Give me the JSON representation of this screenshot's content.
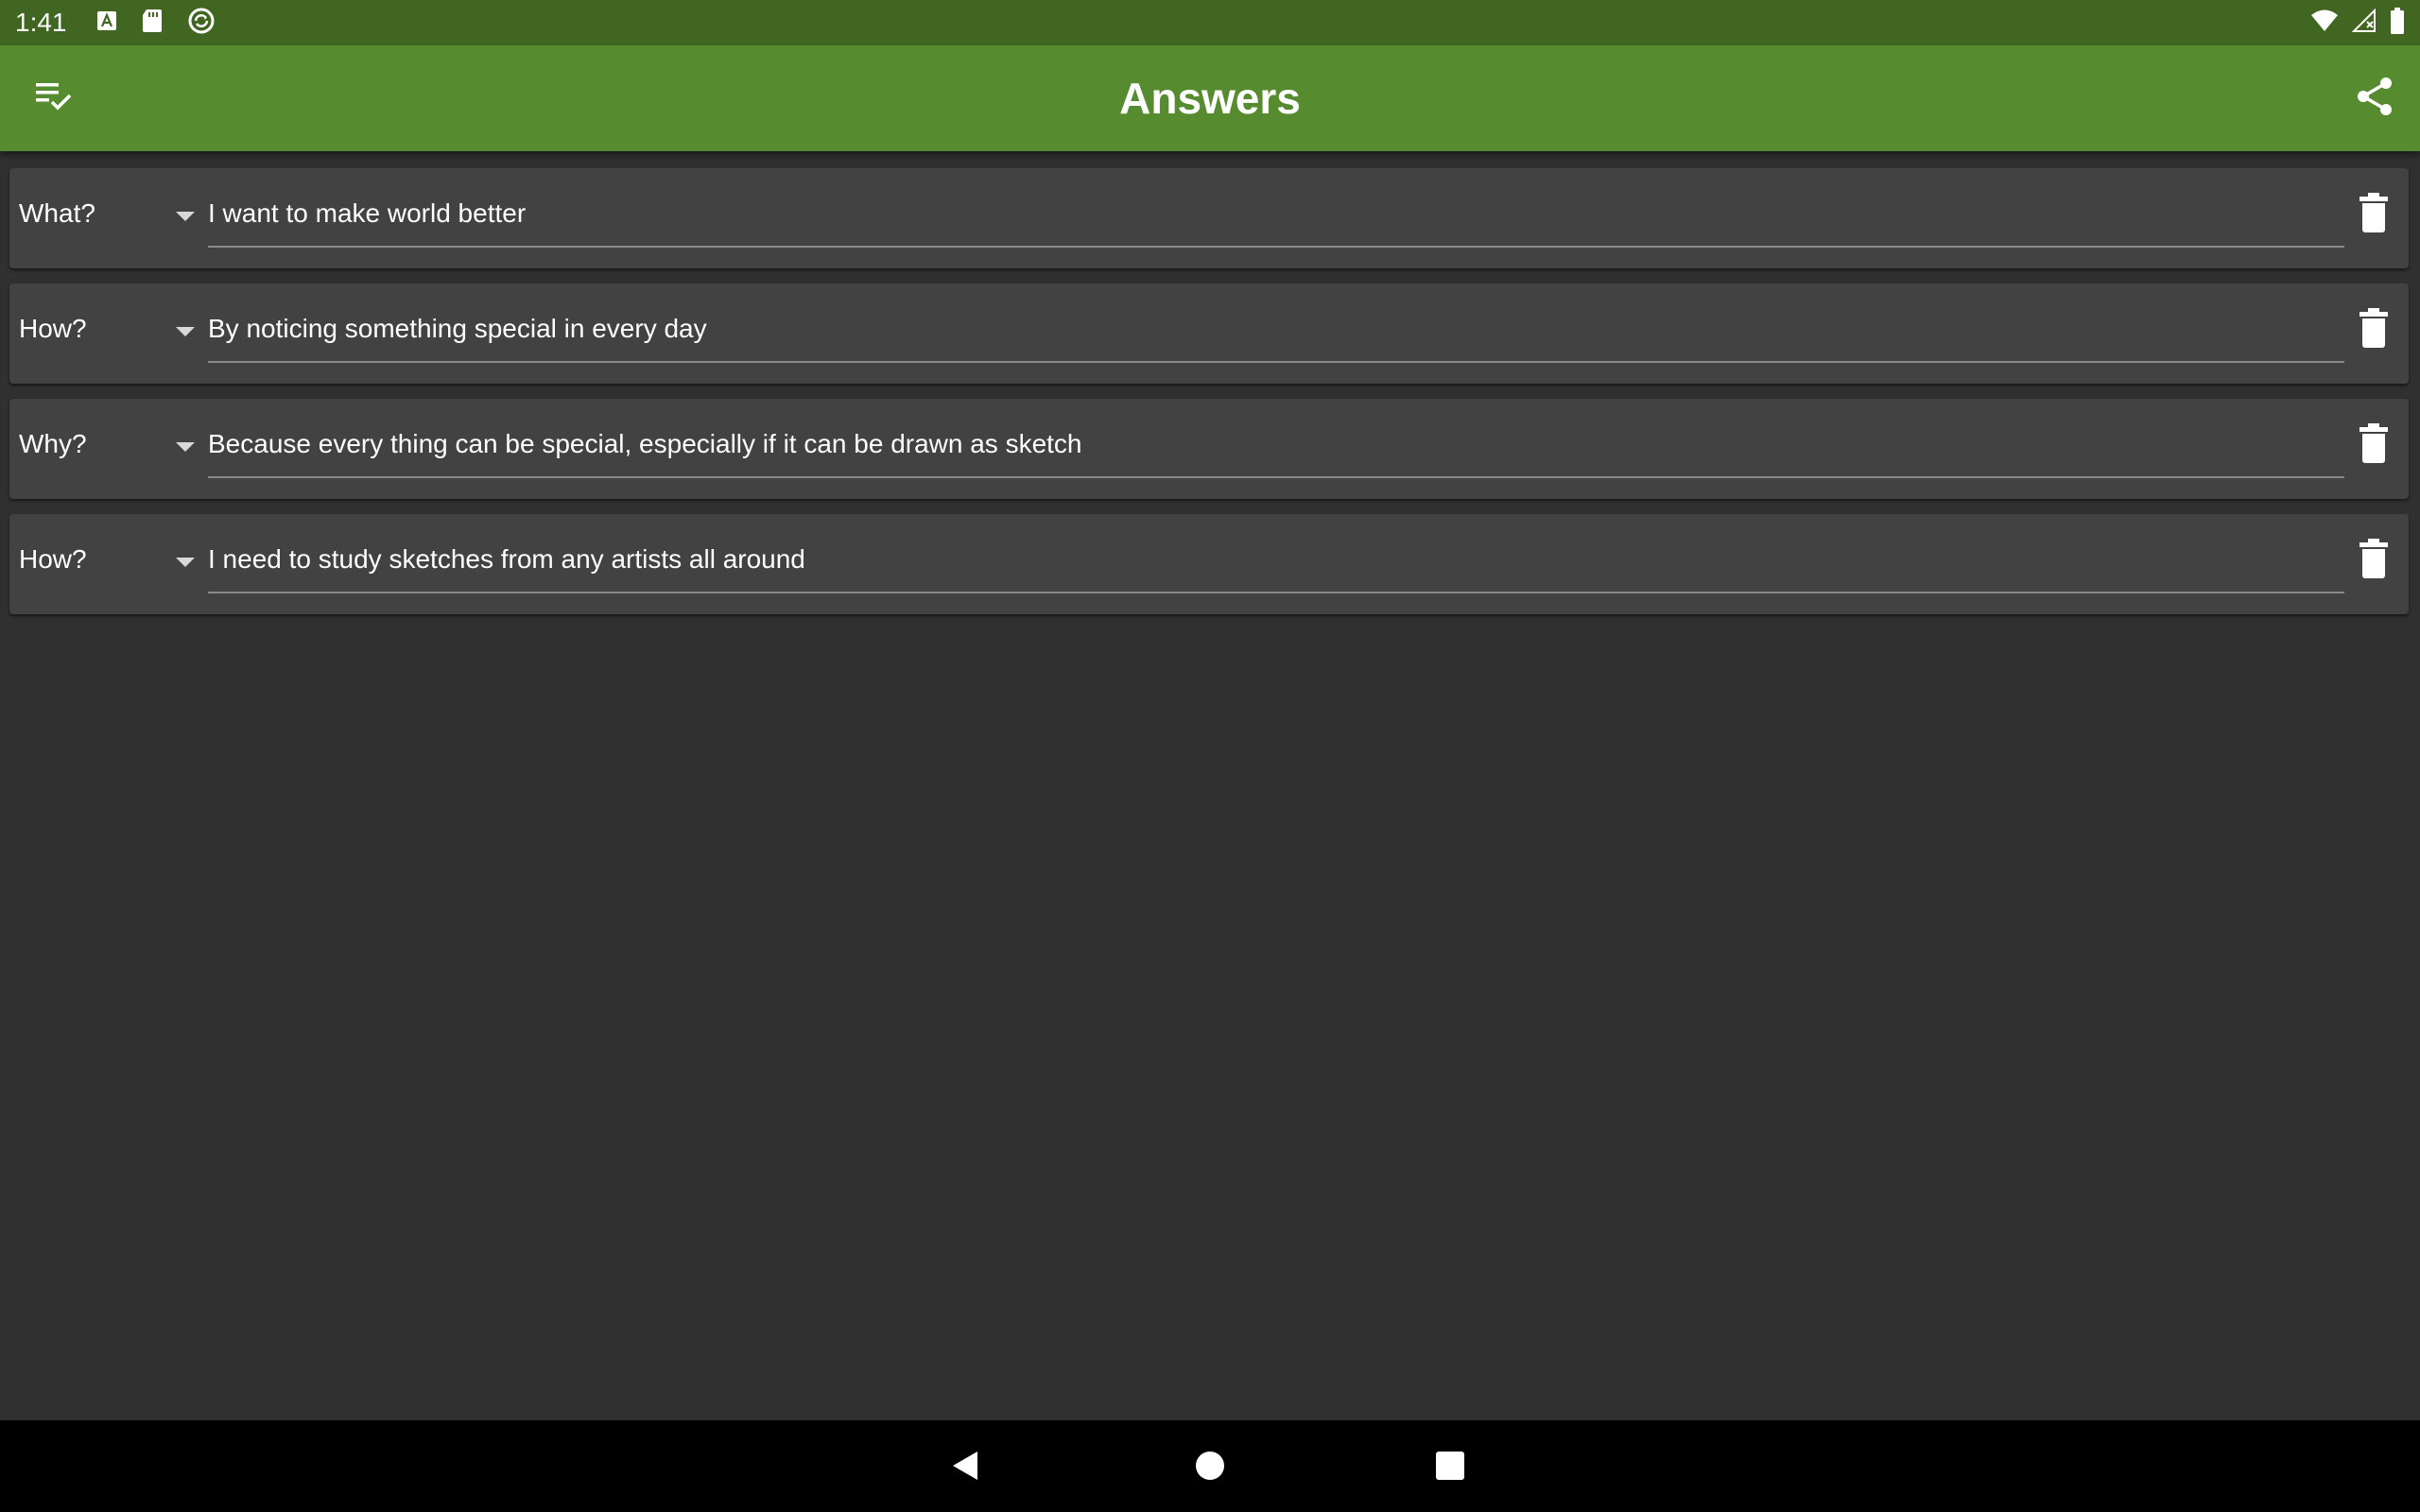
{
  "status_bar": {
    "time": "1:41",
    "left_icons": [
      "font-a-icon",
      "sd-card-icon",
      "sync-icon"
    ],
    "right_icons": [
      "wifi-icon",
      "cell-signal-icon",
      "battery-icon"
    ],
    "color": "#406622"
  },
  "app_bar": {
    "title": "Answers",
    "left_icon": "playlist-check-icon",
    "right_icon": "share-icon",
    "color": "#568b2f"
  },
  "rows": [
    {
      "type": "What?",
      "answer": "I want to make world better"
    },
    {
      "type": "How?",
      "answer": "By noticing something special in every day"
    },
    {
      "type": "Why?",
      "answer": "Because every thing can be special, especially if it can be drawn as sketch"
    },
    {
      "type": "How?",
      "answer": "I need to study sketches from any artists all around"
    }
  ],
  "nav_bar": {
    "buttons": [
      "back-icon",
      "home-icon",
      "recents-icon"
    ]
  },
  "colors": {
    "background": "#303030",
    "card": "#424242"
  }
}
